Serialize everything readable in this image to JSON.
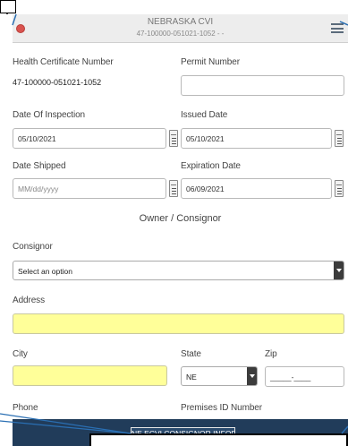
{
  "header": {
    "title": "NEBRASKA CVI",
    "subtitle": "47-100000-051021-1052 - -"
  },
  "form": {
    "health_certificate_number": {
      "label": "Health Certificate Number",
      "value": "47-100000-051021-1052"
    },
    "permit_number": {
      "label": "Permit Number",
      "value": ""
    },
    "date_of_inspection": {
      "label": "Date Of Inspection",
      "value": "05/10/2021"
    },
    "issued_date": {
      "label": "Issued Date",
      "value": "05/10/2021"
    },
    "date_shipped": {
      "label": "Date Shipped",
      "placeholder": "MM/dd/yyyy"
    },
    "expiration_date": {
      "label": "Expiration Date",
      "value": "06/09/2021"
    },
    "section_title": "Owner / Consignor",
    "consignor": {
      "label": "Consignor",
      "value": "Select an option"
    },
    "address": {
      "label": "Address",
      "value": ""
    },
    "city": {
      "label": "City",
      "value": ""
    },
    "state": {
      "label": "State",
      "value": "NE"
    },
    "zip": {
      "label": "Zip",
      "value": "_____-____"
    },
    "phone": {
      "label": "Phone"
    },
    "premises_id": {
      "label": "Premises ID Number"
    }
  },
  "footer": {
    "consignor_info_button": "NE ECVI CONSIGNOR INFORMATION"
  },
  "colors": {
    "required_field": "#ffff99",
    "footer_bar": "#213c5a",
    "close_button": "#d9534f"
  },
  "icons": [
    "close-icon",
    "menu-icon",
    "calendar-icon",
    "dropdown-arrow-icon"
  ]
}
